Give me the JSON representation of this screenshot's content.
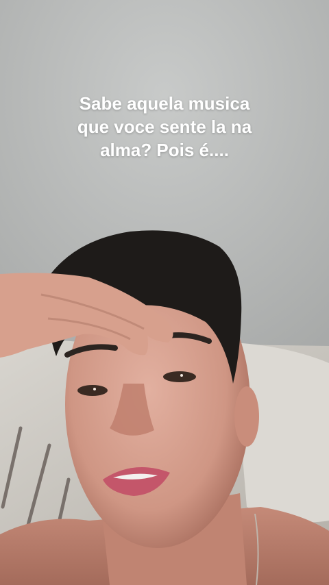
{
  "story": {
    "caption_lines": [
      "Sabe aquela musica",
      "que voce sente la na",
      "alma? Pois é...."
    ]
  }
}
